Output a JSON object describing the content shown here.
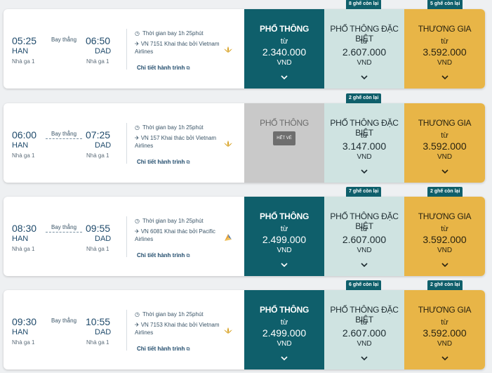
{
  "colors": {
    "economy": "#0f5f6b",
    "economy_sold_out": "#c9c9c9",
    "premium_economy": "#cfe3e1",
    "business": "#e8b547",
    "badge": "#0f5f6b"
  },
  "labels": {
    "details_link": "Chi tiết hành trình",
    "from": "từ",
    "currency": "VND",
    "sold_out": "HẾT VÉ"
  },
  "flights": [
    {
      "dep_time": "05:25",
      "dep_code": "HAN",
      "dep_terminal": "Nhà ga 1",
      "stops": "Bay thẳng",
      "arr_time": "06:50",
      "arr_code": "DAD",
      "arr_terminal": "Nhà ga 1",
      "duration": "Thời gian bay 1h 25phút",
      "operator": "VN 7151 Khai thác bởi Vietnam Airlines",
      "airline_logo": "lotus-logo",
      "fares": {
        "economy": {
          "name": "PHỔ THÔNG",
          "price": "2.340.000",
          "seats_left": ""
        },
        "premium": {
          "name": "PHỔ THÔNG ĐẶC BIỆT",
          "price": "2.607.000",
          "seats_left": "8 ghế còn lại"
        },
        "business": {
          "name": "THƯƠNG GIA",
          "price": "3.592.000",
          "seats_left": "5 ghế còn lại"
        }
      }
    },
    {
      "dep_time": "06:00",
      "dep_code": "HAN",
      "dep_terminal": "Nhà ga 1",
      "stops": "Bay thẳng",
      "arr_time": "07:25",
      "arr_code": "DAD",
      "arr_terminal": "Nhà ga 1",
      "duration": "Thời gian bay 1h 25phút",
      "operator": "VN 157 Khai thác bởi Vietnam Airlines",
      "airline_logo": "lotus-logo",
      "fares": {
        "economy": {
          "name": "PHỔ THÔNG",
          "price": "",
          "seats_left": "",
          "sold_out": true
        },
        "premium": {
          "name": "PHỔ THÔNG ĐẶC BIỆT",
          "price": "3.147.000",
          "seats_left": "2 ghế còn lại"
        },
        "business": {
          "name": "THƯƠNG GIA",
          "price": "3.592.000",
          "seats_left": ""
        }
      }
    },
    {
      "dep_time": "08:30",
      "dep_code": "HAN",
      "dep_terminal": "Nhà ga 1",
      "stops": "Bay thẳng",
      "arr_time": "09:55",
      "arr_code": "DAD",
      "arr_terminal": "Nhà ga 1",
      "duration": "Thời gian bay 1h 25phút",
      "operator": "VN 6081 Khai thác bởi Pacific Airlines",
      "airline_logo": "pacific-airlines-logo",
      "fares": {
        "economy": {
          "name": "PHỔ THÔNG",
          "price": "2.499.000",
          "seats_left": ""
        },
        "premium": {
          "name": "PHỔ THÔNG ĐẶC BIỆT",
          "price": "2.607.000",
          "seats_left": "7 ghế còn lại"
        },
        "business": {
          "name": "THƯƠNG GIA",
          "price": "3.592.000",
          "seats_left": "2 ghế còn lại"
        }
      }
    },
    {
      "dep_time": "09:30",
      "dep_code": "HAN",
      "dep_terminal": "Nhà ga 1",
      "stops": "Bay thẳng",
      "arr_time": "10:55",
      "arr_code": "DAD",
      "arr_terminal": "Nhà ga 1",
      "duration": "Thời gian bay 1h 25phút",
      "operator": "VN 7153 Khai thác bởi Vietnam Airlines",
      "airline_logo": "lotus-logo",
      "fares": {
        "economy": {
          "name": "PHỔ THÔNG",
          "price": "2.499.000",
          "seats_left": ""
        },
        "premium": {
          "name": "PHỔ THÔNG ĐẶC BIỆT",
          "price": "2.607.000",
          "seats_left": "6 ghế còn lại"
        },
        "business": {
          "name": "THƯƠNG GIA",
          "price": "3.592.000",
          "seats_left": "2 ghế còn lại"
        }
      }
    }
  ]
}
